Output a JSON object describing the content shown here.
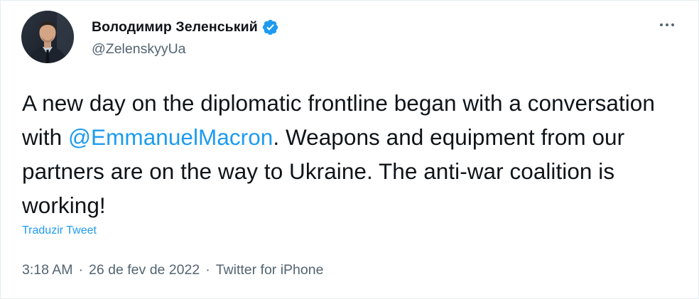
{
  "author": {
    "display_name": "Володимир Зеленський",
    "handle": "@ZelenskyyUa",
    "verified": true
  },
  "tweet": {
    "text_before_mention": "A new day on the diplomatic frontline began with a conversation with ",
    "mention": "@EmmanuelMacron",
    "text_after_mention": ". Weapons and equipment from our partners are on the way to Ukraine. The anti-war coalition is working!",
    "translate_label": "Traduzir Tweet"
  },
  "meta": {
    "time": "3:18 AM",
    "separator": "·",
    "date": "26 de fev de 2022",
    "source": "Twitter for iPhone"
  },
  "colors": {
    "accent": "#1d9bf0",
    "text": "#0f1419",
    "secondary": "#536471"
  },
  "icons": {
    "verified": "verified-badge-icon",
    "more": "more-options-icon"
  }
}
